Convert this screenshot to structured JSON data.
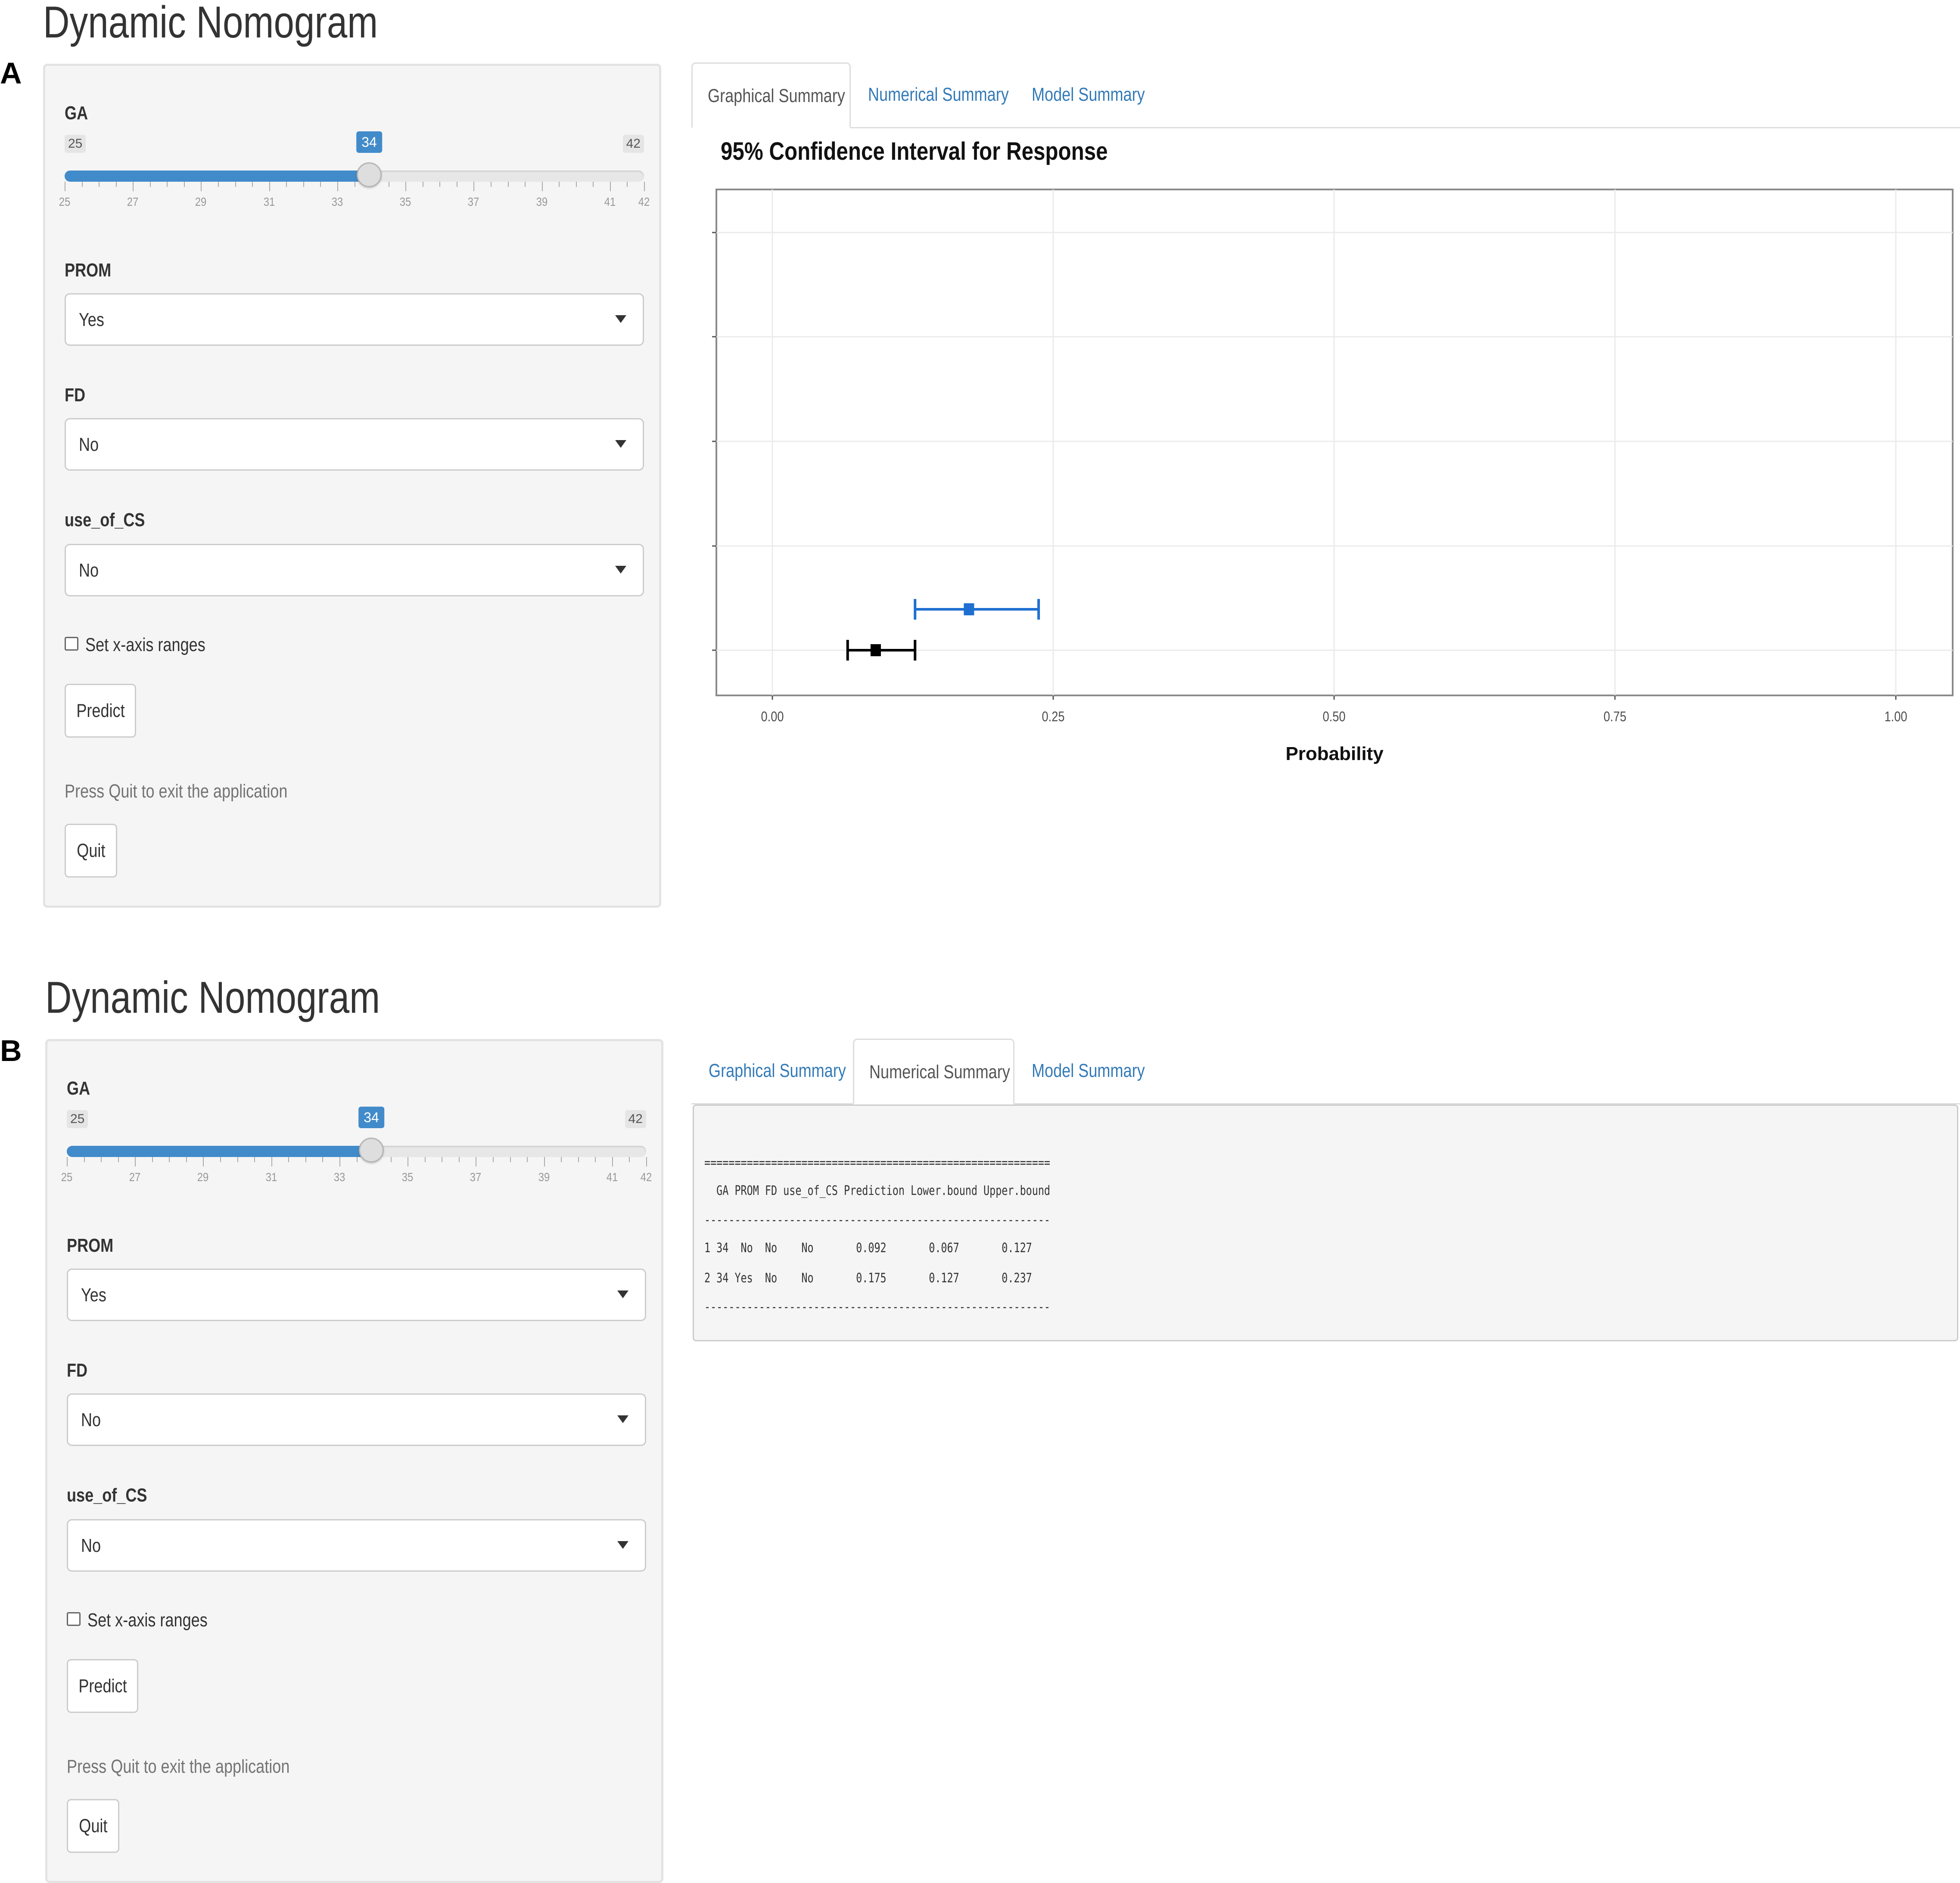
{
  "panels": [
    {
      "letter": "A",
      "app_title": "Dynamic Nomogram",
      "inputs": {
        "ga": {
          "label": "GA",
          "min": "25",
          "max": "42",
          "value": "34",
          "ticks": [
            "25",
            "27",
            "29",
            "31",
            "33",
            "35",
            "37",
            "39",
            "41",
            "42"
          ]
        },
        "prom": {
          "label": "PROM",
          "value": "Yes"
        },
        "fd": {
          "label": "FD",
          "value": "No"
        },
        "use_of_cs": {
          "label": "use_of_CS",
          "value": "No"
        },
        "xaxis_checkbox": "Set x-axis ranges",
        "predict_button": "Predict",
        "quit_help": "Press Quit to exit the application",
        "quit_button": "Quit"
      },
      "tabs": [
        "Graphical Summary",
        "Numerical Summary",
        "Model Summary"
      ],
      "active_tab": "Graphical Summary"
    },
    {
      "letter": "B",
      "app_title": "Dynamic Nomogram",
      "inputs": {
        "ga": {
          "label": "GA",
          "min": "25",
          "max": "42",
          "value": "34",
          "ticks": [
            "25",
            "27",
            "29",
            "31",
            "33",
            "35",
            "37",
            "39",
            "41",
            "42"
          ]
        },
        "prom": {
          "label": "PROM",
          "value": "Yes"
        },
        "fd": {
          "label": "FD",
          "value": "No"
        },
        "use_of_cs": {
          "label": "use_of_CS",
          "value": "No"
        },
        "xaxis_checkbox": "Set x-axis ranges",
        "predict_button": "Predict",
        "quit_help": "Press Quit to exit the application",
        "quit_button": "Quit"
      },
      "tabs": [
        "Graphical Summary",
        "Numerical Summary",
        "Model Summary"
      ],
      "active_tab": "Numerical Summary",
      "numerical_summary": {
        "lines": [
          "=========================================================",
          "  GA PROM FD use_of_CS Prediction Lower.bound Upper.bound",
          "---------------------------------------------------------",
          "1 34  No  No    No       0.092       0.067       0.127",
          "2 34 Yes  No    No       0.175       0.127       0.237",
          "---------------------------------------------------------"
        ]
      }
    }
  ],
  "chart_data": {
    "type": "scatter",
    "title": "95% Confidence Interval for Response",
    "xlabel": "Probability",
    "ylabel": "",
    "xlim": [
      -0.1,
      2.1
    ],
    "xticks": [
      "0.00",
      "0.25",
      "0.50",
      "0.75",
      "1.00"
    ],
    "grid": true,
    "series": [
      {
        "point": 0.092,
        "lower": 0.067,
        "upper": 0.127,
        "color": "#000000"
      },
      {
        "point": 0.175,
        "lower": 0.127,
        "upper": 0.237,
        "color": "#1f6fd1"
      }
    ]
  }
}
